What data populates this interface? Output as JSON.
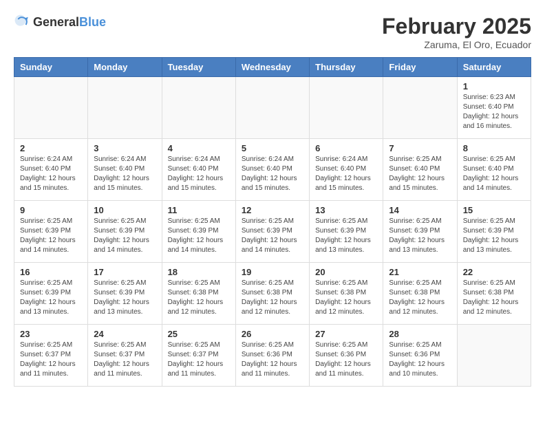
{
  "header": {
    "logo_general": "General",
    "logo_blue": "Blue",
    "month_year": "February 2025",
    "location": "Zaruma, El Oro, Ecuador"
  },
  "days_of_week": [
    "Sunday",
    "Monday",
    "Tuesday",
    "Wednesday",
    "Thursday",
    "Friday",
    "Saturday"
  ],
  "weeks": [
    [
      {
        "day": "",
        "info": ""
      },
      {
        "day": "",
        "info": ""
      },
      {
        "day": "",
        "info": ""
      },
      {
        "day": "",
        "info": ""
      },
      {
        "day": "",
        "info": ""
      },
      {
        "day": "",
        "info": ""
      },
      {
        "day": "1",
        "info": "Sunrise: 6:23 AM\nSunset: 6:40 PM\nDaylight: 12 hours\nand 16 minutes."
      }
    ],
    [
      {
        "day": "2",
        "info": "Sunrise: 6:24 AM\nSunset: 6:40 PM\nDaylight: 12 hours\nand 15 minutes."
      },
      {
        "day": "3",
        "info": "Sunrise: 6:24 AM\nSunset: 6:40 PM\nDaylight: 12 hours\nand 15 minutes."
      },
      {
        "day": "4",
        "info": "Sunrise: 6:24 AM\nSunset: 6:40 PM\nDaylight: 12 hours\nand 15 minutes."
      },
      {
        "day": "5",
        "info": "Sunrise: 6:24 AM\nSunset: 6:40 PM\nDaylight: 12 hours\nand 15 minutes."
      },
      {
        "day": "6",
        "info": "Sunrise: 6:24 AM\nSunset: 6:40 PM\nDaylight: 12 hours\nand 15 minutes."
      },
      {
        "day": "7",
        "info": "Sunrise: 6:25 AM\nSunset: 6:40 PM\nDaylight: 12 hours\nand 15 minutes."
      },
      {
        "day": "8",
        "info": "Sunrise: 6:25 AM\nSunset: 6:40 PM\nDaylight: 12 hours\nand 14 minutes."
      }
    ],
    [
      {
        "day": "9",
        "info": "Sunrise: 6:25 AM\nSunset: 6:39 PM\nDaylight: 12 hours\nand 14 minutes."
      },
      {
        "day": "10",
        "info": "Sunrise: 6:25 AM\nSunset: 6:39 PM\nDaylight: 12 hours\nand 14 minutes."
      },
      {
        "day": "11",
        "info": "Sunrise: 6:25 AM\nSunset: 6:39 PM\nDaylight: 12 hours\nand 14 minutes."
      },
      {
        "day": "12",
        "info": "Sunrise: 6:25 AM\nSunset: 6:39 PM\nDaylight: 12 hours\nand 14 minutes."
      },
      {
        "day": "13",
        "info": "Sunrise: 6:25 AM\nSunset: 6:39 PM\nDaylight: 12 hours\nand 13 minutes."
      },
      {
        "day": "14",
        "info": "Sunrise: 6:25 AM\nSunset: 6:39 PM\nDaylight: 12 hours\nand 13 minutes."
      },
      {
        "day": "15",
        "info": "Sunrise: 6:25 AM\nSunset: 6:39 PM\nDaylight: 12 hours\nand 13 minutes."
      }
    ],
    [
      {
        "day": "16",
        "info": "Sunrise: 6:25 AM\nSunset: 6:39 PM\nDaylight: 12 hours\nand 13 minutes."
      },
      {
        "day": "17",
        "info": "Sunrise: 6:25 AM\nSunset: 6:39 PM\nDaylight: 12 hours\nand 13 minutes."
      },
      {
        "day": "18",
        "info": "Sunrise: 6:25 AM\nSunset: 6:38 PM\nDaylight: 12 hours\nand 12 minutes."
      },
      {
        "day": "19",
        "info": "Sunrise: 6:25 AM\nSunset: 6:38 PM\nDaylight: 12 hours\nand 12 minutes."
      },
      {
        "day": "20",
        "info": "Sunrise: 6:25 AM\nSunset: 6:38 PM\nDaylight: 12 hours\nand 12 minutes."
      },
      {
        "day": "21",
        "info": "Sunrise: 6:25 AM\nSunset: 6:38 PM\nDaylight: 12 hours\nand 12 minutes."
      },
      {
        "day": "22",
        "info": "Sunrise: 6:25 AM\nSunset: 6:38 PM\nDaylight: 12 hours\nand 12 minutes."
      }
    ],
    [
      {
        "day": "23",
        "info": "Sunrise: 6:25 AM\nSunset: 6:37 PM\nDaylight: 12 hours\nand 11 minutes."
      },
      {
        "day": "24",
        "info": "Sunrise: 6:25 AM\nSunset: 6:37 PM\nDaylight: 12 hours\nand 11 minutes."
      },
      {
        "day": "25",
        "info": "Sunrise: 6:25 AM\nSunset: 6:37 PM\nDaylight: 12 hours\nand 11 minutes."
      },
      {
        "day": "26",
        "info": "Sunrise: 6:25 AM\nSunset: 6:36 PM\nDaylight: 12 hours\nand 11 minutes."
      },
      {
        "day": "27",
        "info": "Sunrise: 6:25 AM\nSunset: 6:36 PM\nDaylight: 12 hours\nand 11 minutes."
      },
      {
        "day": "28",
        "info": "Sunrise: 6:25 AM\nSunset: 6:36 PM\nDaylight: 12 hours\nand 10 minutes."
      },
      {
        "day": "",
        "info": ""
      }
    ]
  ]
}
